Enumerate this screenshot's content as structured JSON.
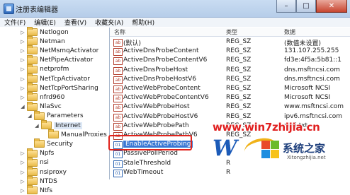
{
  "window": {
    "title": "注册表编辑器",
    "controls": {
      "minimize": "–",
      "maximize": "□",
      "close": "✕"
    }
  },
  "menu": [
    "文件(F)",
    "编辑(E)",
    "查看(V)",
    "收藏夹(A)",
    "帮助(H)"
  ],
  "tree": [
    {
      "label": "Netlogon",
      "expander": "▷",
      "level": 0
    },
    {
      "label": "Netman",
      "expander": "▷",
      "level": 0
    },
    {
      "label": "NetMsmqActivator",
      "expander": "▷",
      "level": 0
    },
    {
      "label": "NetPipeActivator",
      "expander": "▷",
      "level": 0
    },
    {
      "label": "netprofm",
      "expander": "▷",
      "level": 0
    },
    {
      "label": "NetTcpActivator",
      "expander": "▷",
      "level": 0
    },
    {
      "label": "NetTcpPortSharing",
      "expander": "▷",
      "level": 0
    },
    {
      "label": "nfrd960",
      "expander": "▷",
      "level": 0
    },
    {
      "label": "NlaSvc",
      "expander": "◢",
      "level": 0
    },
    {
      "label": "Parameters",
      "expander": "◢",
      "level": 1
    },
    {
      "label": "Internet",
      "expander": "◢",
      "level": 2
    },
    {
      "label": "ManualProxies",
      "expander": "",
      "level": 3
    },
    {
      "label": "Security",
      "expander": "",
      "level": 1
    },
    {
      "label": "Npfs",
      "expander": "▷",
      "level": 0
    },
    {
      "label": "nsi",
      "expander": "▷",
      "level": 0
    },
    {
      "label": "nsiproxy",
      "expander": "▷",
      "level": 0
    },
    {
      "label": "NTDS",
      "expander": "▷",
      "level": 0
    },
    {
      "label": "Ntfs",
      "expander": "▷",
      "level": 0
    }
  ],
  "list": {
    "columns": {
      "name": "名称",
      "type": "类型",
      "data": "数据"
    },
    "rows": [
      {
        "icon": "ab",
        "name": "(默认)",
        "type": "REG_SZ",
        "data": "(数值未设置)"
      },
      {
        "icon": "ab",
        "name": "ActiveDnsProbeContent",
        "type": "REG_SZ",
        "data": "131.107.255.255"
      },
      {
        "icon": "ab",
        "name": "ActiveDnsProbeContentV6",
        "type": "REG_SZ",
        "data": "fd3e:4f5a:5b81::1"
      },
      {
        "icon": "ab",
        "name": "ActiveDnsProbeHost",
        "type": "REG_SZ",
        "data": "dns.msftncsi.com"
      },
      {
        "icon": "ab",
        "name": "ActiveDnsProbeHostV6",
        "type": "REG_SZ",
        "data": "dns.msftncsi.com"
      },
      {
        "icon": "ab",
        "name": "ActiveWebProbeContent",
        "type": "REG_SZ",
        "data": "Microsoft NCSI"
      },
      {
        "icon": "ab",
        "name": "ActiveWebProbeContentV6",
        "type": "REG_SZ",
        "data": "Microsoft NCSI"
      },
      {
        "icon": "ab",
        "name": "ActiveWebProbeHost",
        "type": "REG_SZ",
        "data": "www.msftncsi.com"
      },
      {
        "icon": "ab",
        "name": "ActiveWebProbeHostV6",
        "type": "REG_SZ",
        "data": "ipv6.msftncsi.com"
      },
      {
        "icon": "ab",
        "name": "ActiveWebProbePath",
        "type": "REG_SZ",
        "data": "ncsi.txt"
      },
      {
        "icon": "ab",
        "name": "ActiveWebProbePathV6",
        "type": "REG_SZ",
        "data": ""
      },
      {
        "icon": "01",
        "name": "EnableActiveProbing",
        "type": "R",
        "data": ""
      },
      {
        "icon": "01",
        "name": "PassivePollPeriod",
        "type": "R",
        "data": ""
      },
      {
        "icon": "01",
        "name": "StaleThreshold",
        "type": "R",
        "data": ""
      },
      {
        "icon": "01",
        "name": "WebTimeout",
        "type": "R",
        "data": ""
      }
    ]
  },
  "watermark": {
    "url": "www.win7zhijia.cn",
    "logo_letter": "W",
    "site": "系统之家",
    "site_small": "Xitongzhijia.net"
  }
}
